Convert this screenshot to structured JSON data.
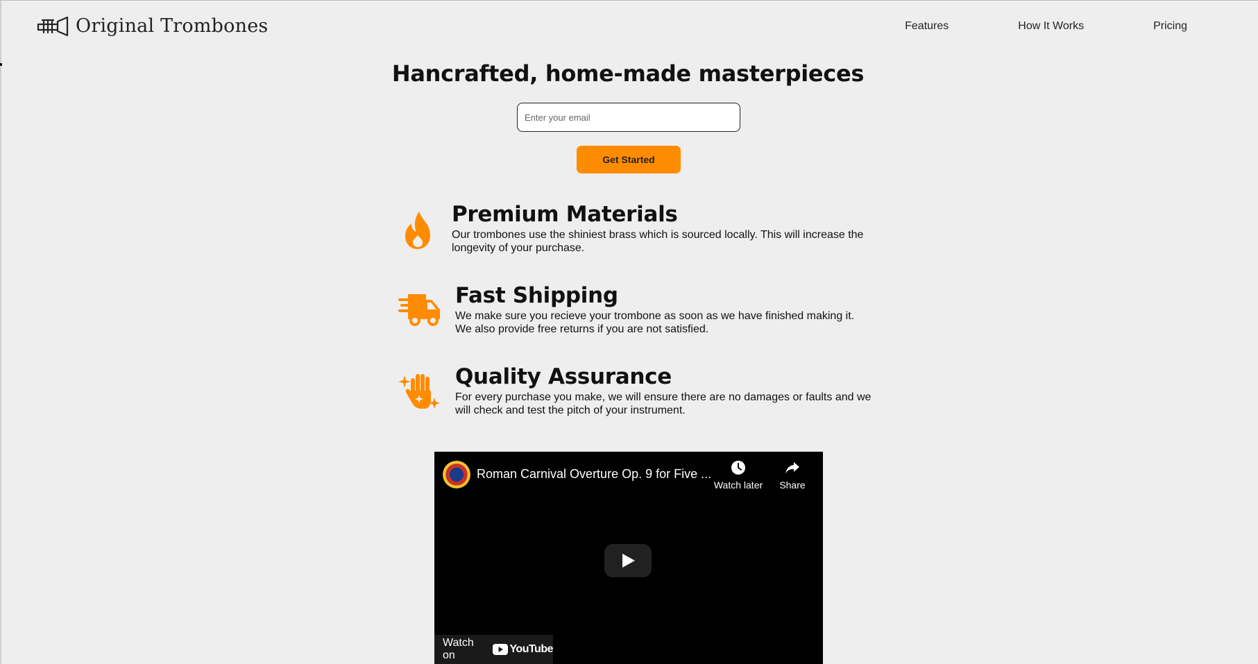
{
  "brand": {
    "name": "Original Trombones",
    "icon": "trombone-logo-icon"
  },
  "nav": [
    {
      "label": "Features"
    },
    {
      "label": "How It Works"
    },
    {
      "label": "Pricing"
    }
  ],
  "hero": {
    "title": "Hancrafted, home-made masterpieces",
    "email_placeholder": "Enter your email",
    "email_value": "",
    "cta_label": "Get Started"
  },
  "features": [
    {
      "icon": "fire-icon",
      "title": "Premium Materials",
      "text": "Our trombones use the shiniest brass which is sourced locally. This will increase the longevity of your purchase."
    },
    {
      "icon": "truck-icon",
      "title": "Fast Shipping",
      "text": "We make sure you recieve your trombone as soon as we have finished making it. We also provide free returns if you are not satisfied."
    },
    {
      "icon": "sparkle-hand-icon",
      "title": "Quality Assurance",
      "text": "For every purchase you make, we will ensure there are no damages or faults and we will check and test the pitch of your instrument."
    }
  ],
  "video": {
    "title": "Roman Carnival Overture Op. 9 for Five ...",
    "watch_later": "Watch later",
    "share": "Share",
    "watch_on": "Watch on",
    "youtube": "YouTube"
  },
  "colors": {
    "accent": "#ff8c00",
    "background": "#eeeeee"
  }
}
